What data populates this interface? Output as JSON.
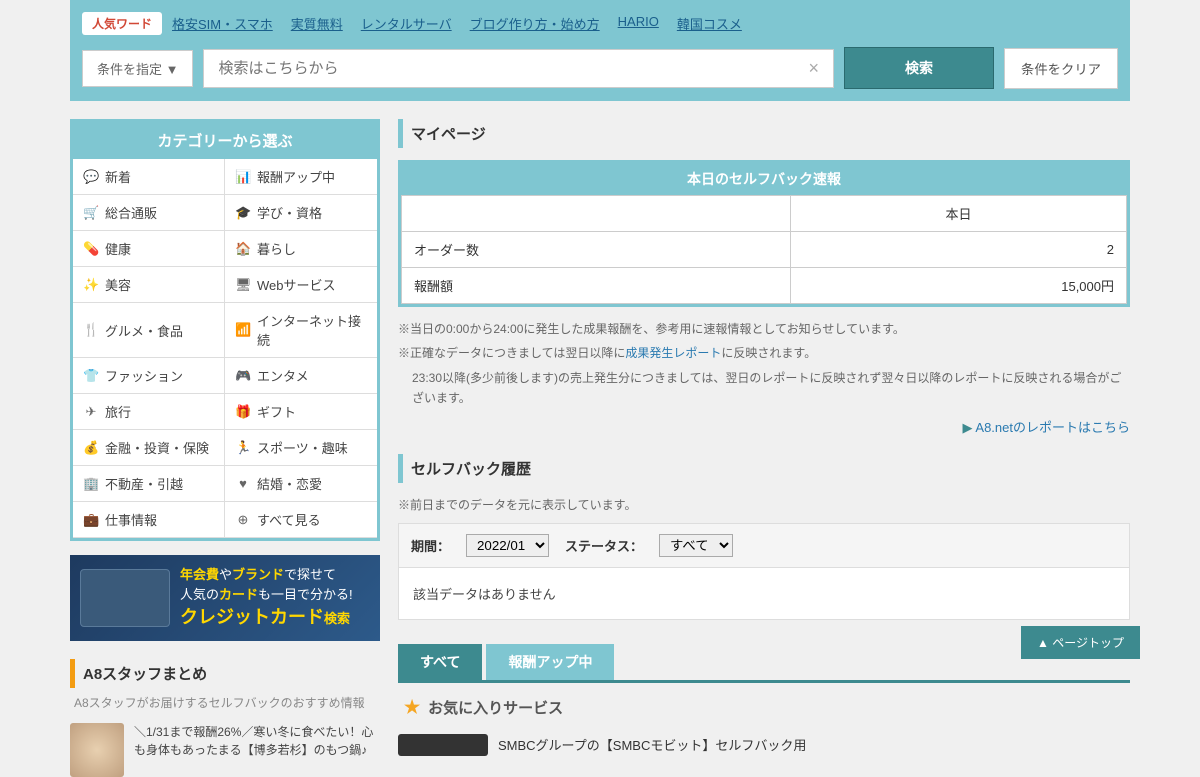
{
  "search": {
    "popular_label": "人気ワード",
    "links": [
      "格安SIM・スマホ",
      "実質無料",
      "レンタルサーバ",
      "ブログ作り方・始め方",
      "HARIO",
      "韓国コスメ"
    ],
    "condition_btn": "条件を指定 ▼",
    "placeholder": "検索はこちらから",
    "search_btn": "検索",
    "clear_btn": "条件をクリア"
  },
  "categories": {
    "title": "カテゴリーから選ぶ",
    "items": [
      {
        "icon": "💬",
        "label": "新着"
      },
      {
        "icon": "📊",
        "label": "報酬アップ中"
      },
      {
        "icon": "🛒",
        "label": "総合通販"
      },
      {
        "icon": "🎓",
        "label": "学び・資格"
      },
      {
        "icon": "💊",
        "label": "健康"
      },
      {
        "icon": "🏠",
        "label": "暮らし"
      },
      {
        "icon": "✨",
        "label": "美容"
      },
      {
        "icon": "🖥",
        "label": "Webサービス"
      },
      {
        "icon": "🍴",
        "label": "グルメ・食品"
      },
      {
        "icon": "📶",
        "label": "インターネット接続"
      },
      {
        "icon": "👕",
        "label": "ファッション"
      },
      {
        "icon": "🎮",
        "label": "エンタメ"
      },
      {
        "icon": "✈",
        "label": "旅行"
      },
      {
        "icon": "🎁",
        "label": "ギフト"
      },
      {
        "icon": "💰",
        "label": "金融・投資・保険"
      },
      {
        "icon": "🏃",
        "label": "スポーツ・趣味"
      },
      {
        "icon": "🏢",
        "label": "不動産・引越"
      },
      {
        "icon": "♥",
        "label": "結婚・恋愛"
      },
      {
        "icon": "💼",
        "label": "仕事情報"
      },
      {
        "icon": "⊕",
        "label": "すべて見る"
      }
    ]
  },
  "banner": {
    "line1a": "年会費",
    "line1b": "や",
    "line1c": "ブランド",
    "line1d": "で探せて",
    "line2a": "人気の",
    "line2b": "カード",
    "line2c": "も一目で分かる!",
    "line3a": "クレジットカード",
    "line3b": "検索"
  },
  "matome": {
    "title": "A8スタッフまとめ",
    "sub": "A8スタッフがお届けするセルフバックのおすすめ情報",
    "item": "＼1/31まで報酬26%／寒い冬に食べたい！心も身体もあったまる【博多若杉】のもつ鍋♪"
  },
  "mypage": {
    "title": "マイページ",
    "report_title": "本日のセルフバック速報",
    "col_today": "本日",
    "row_orders": "オーダー数",
    "val_orders": "2",
    "row_reward": "報酬額",
    "val_reward": "15,000円",
    "note1": "※当日の0:00から24:00に発生した成果報酬を、参考用に速報情報としてお知らせしています。",
    "note2a": "※正確なデータにつきましては翌日以降に",
    "note2link": "成果発生レポート",
    "note2b": "に反映されます。",
    "note3": "23:30以降(多少前後します)の売上発生分につきましては、翌日のレポートに反映されず翌々日以降のレポートに反映される場合がございます。",
    "report_link": "A8.netのレポートはこちら"
  },
  "history": {
    "title": "セルフバック履歴",
    "note": "※前日までのデータを元に表示しています。",
    "period_label": "期間：",
    "period_value": "2022/01",
    "status_label": "ステータス：",
    "status_value": "すべて",
    "no_data": "該当データはありません"
  },
  "tabs": {
    "all": "すべて",
    "reward_up": "報酬アップ中"
  },
  "favorites": {
    "title": "お気に入りサービス",
    "service1": "SMBCグループの【SMBCモビット】セルフバック用"
  },
  "page_top": "ページトップ"
}
